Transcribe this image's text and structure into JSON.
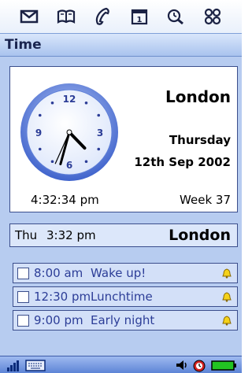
{
  "toolbar": {
    "icons": [
      "envelope-icon",
      "book-icon",
      "phone-icon",
      "calendar-icon",
      "clock-search-icon",
      "grid-icon"
    ]
  },
  "title": "Time",
  "clock": {
    "city": "London",
    "weekday": "Thursday",
    "date": "12th Sep 2002",
    "time": "4:32:34 pm",
    "week": "Week 37",
    "numerals": [
      "12",
      "3",
      "6",
      "9"
    ],
    "hands": {
      "hour": 4,
      "minute": 32,
      "second": 34
    }
  },
  "second_city": {
    "day": "Thu",
    "time": "3:32 pm",
    "city": "London"
  },
  "alarms": [
    {
      "time": "8:00 am",
      "label": "Wake up!"
    },
    {
      "time": "12:30 pm",
      "label": "Lunchtime"
    },
    {
      "time": "9:00 pm",
      "label": "Early night"
    }
  ],
  "statusbar": {
    "icons": [
      "signal-strength-icon",
      "keyboard-icon",
      "speaker-icon",
      "alarm-active-icon",
      "battery-icon"
    ]
  },
  "colors": {
    "background": "#b7ccf0",
    "accent": "#2c3d97",
    "battery": "#22c422"
  }
}
